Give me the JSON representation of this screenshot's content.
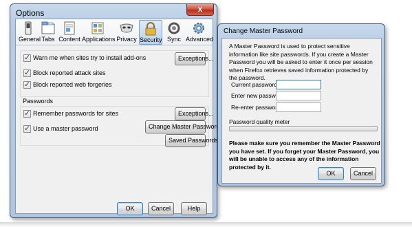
{
  "options_window": {
    "title": "Options",
    "close_label": "x",
    "tabs": [
      {
        "label": "General",
        "icon": "general-switch-icon",
        "active": false
      },
      {
        "label": "Tabs",
        "icon": "tabs-icon",
        "active": false
      },
      {
        "label": "Content",
        "icon": "content-page-icon",
        "active": false
      },
      {
        "label": "Applications",
        "icon": "applications-icon",
        "active": false
      },
      {
        "label": "Privacy",
        "icon": "privacy-mask-icon",
        "active": false
      },
      {
        "label": "Security",
        "icon": "security-lock-icon",
        "active": true
      },
      {
        "label": "Sync",
        "icon": "sync-icon",
        "active": false
      },
      {
        "label": "Advanced",
        "icon": "advanced-gear-icon",
        "active": false
      }
    ],
    "security": {
      "warn_addons": {
        "label": "Warn me when sites try to install add-ons",
        "checked": true
      },
      "exceptions1": "Exceptions...",
      "block_attack": {
        "label": "Block reported attack sites",
        "checked": true
      },
      "block_forgeries": {
        "label": "Block reported web forgeries",
        "checked": true
      }
    },
    "passwords": {
      "section_label": "Passwords",
      "remember": {
        "label": "Remember passwords for sites",
        "checked": true
      },
      "exceptions2": "Exceptions...",
      "use_master": {
        "label": "Use a master password",
        "checked": true
      },
      "change_master": "Change Master Password...",
      "saved_passwords": "Saved Passwords..."
    },
    "buttons": {
      "ok": "OK",
      "cancel": "Cancel",
      "help": "Help"
    }
  },
  "master_dialog": {
    "title": "Change Master Password",
    "description": "A Master Password is used to protect sensitive information like site passwords. If you create a Master Password you will be asked to enter it once per session when Firefox retrieves saved information protected by the password.",
    "current_label": "Current password:",
    "new_label": "Enter new password:",
    "reenter_label": "Re-enter password:",
    "current_value": "",
    "new_value": "",
    "reenter_value": "",
    "meter_label": "Password quality meter",
    "meter_level": 0,
    "warning": "Please make sure you remember the Master Password you have set. If you forget your Master Password, you will be unable to access any of the information protected by it.",
    "ok": "OK",
    "cancel": "Cancel"
  },
  "colors": {
    "window_frame": "#b7cde5",
    "active_tab": "#b9d1ea",
    "close_button": "#cc4b36",
    "client_bg": "#f0f0f0"
  }
}
